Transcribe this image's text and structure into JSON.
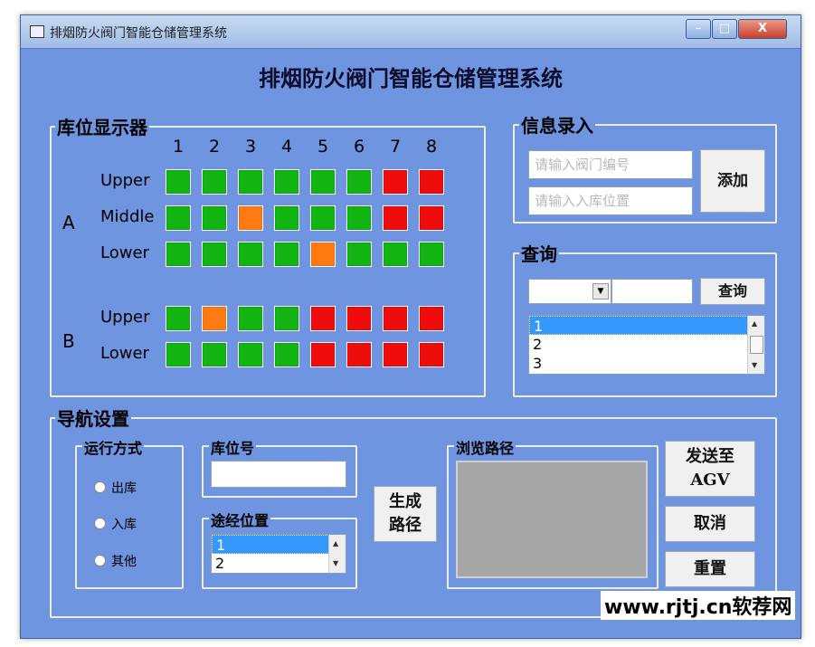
{
  "window": {
    "title": "排烟防火阀门智能仓储管理系统",
    "minimize": "–",
    "maximize": "□",
    "close": "X"
  },
  "app_title": "排烟防火阀门智能仓储管理系统",
  "storage_display": {
    "label": "库位显示器",
    "columns": [
      "1",
      "2",
      "3",
      "4",
      "5",
      "6",
      "7",
      "8"
    ],
    "zones": [
      {
        "name": "A",
        "rows": [
          {
            "label": "Upper",
            "cells": [
              "green",
              "green",
              "green",
              "green",
              "green",
              "green",
              "red",
              "red"
            ]
          },
          {
            "label": "Middle",
            "cells": [
              "green",
              "green",
              "orange",
              "green",
              "green",
              "green",
              "red",
              "red"
            ]
          },
          {
            "label": "Lower",
            "cells": [
              "green",
              "green",
              "green",
              "green",
              "orange",
              "green",
              "green",
              "green"
            ]
          }
        ]
      },
      {
        "name": "B",
        "rows": [
          {
            "label": "Upper",
            "cells": [
              "green",
              "orange",
              "green",
              "green",
              "red",
              "red",
              "red",
              "red"
            ]
          },
          {
            "label": "Lower",
            "cells": [
              "green",
              "green",
              "green",
              "green",
              "red",
              "red",
              "red",
              "red"
            ]
          }
        ]
      }
    ],
    "colors": {
      "green": "#11b411",
      "red": "#ee0c0c",
      "orange": "#ff7a10"
    }
  },
  "info_entry": {
    "label": "信息录入",
    "valve_placeholder": "请输入阀门编号",
    "location_placeholder": "请输入入库位置",
    "add_button": "添加"
  },
  "query": {
    "label": "查询",
    "query_button": "查询",
    "results": [
      "1",
      "2",
      "3"
    ]
  },
  "navigation": {
    "label": "导航设置",
    "mode": {
      "label": "运行方式",
      "options": [
        "出库",
        "入库",
        "其他"
      ]
    },
    "slot_number": {
      "label": "库位号"
    },
    "waypoints": {
      "label": "途经位置",
      "items": [
        "1",
        "2"
      ]
    },
    "generate_button_line1": "生成",
    "generate_button_line2": "路径",
    "browse_path": {
      "label": "浏览路径"
    },
    "send_button_line1": "发送至",
    "send_button_line2": "AGV",
    "cancel_button": "取消",
    "reset_button": "重置"
  },
  "watermark": "www.rjtj.cn软荐网"
}
